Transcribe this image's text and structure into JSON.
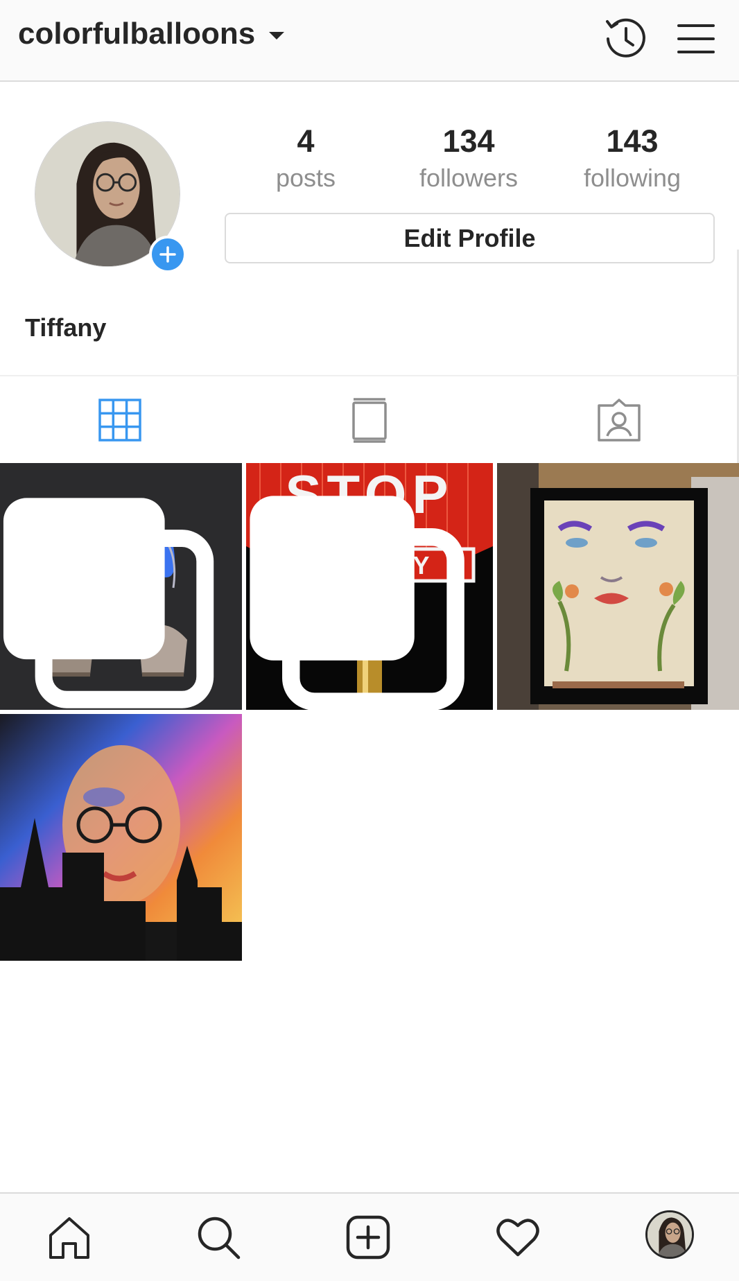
{
  "header": {
    "username": "colorfulballoons",
    "icons": [
      "chevron-down-icon",
      "archive-history-icon",
      "hamburger-menu-icon"
    ]
  },
  "profile": {
    "full_name": "Tiffany",
    "stats": {
      "posts": {
        "count": "4",
        "label": "posts"
      },
      "followers": {
        "count": "134",
        "label": "followers"
      },
      "following": {
        "count": "143",
        "label": "following"
      }
    },
    "edit_button_label": "Edit Profile"
  },
  "tabs": [
    "grid-icon",
    "igtv-icon",
    "tagged-icon"
  ],
  "active_tab": "grid-icon",
  "posts": [
    {
      "subject": "blue light sculptures",
      "multiple": true
    },
    {
      "subject": "stop sign at night",
      "multiple": true
    },
    {
      "subject": "painted face with plants",
      "multiple": false
    },
    {
      "subject": "colorful portrait with skyline",
      "multiple": false
    }
  ],
  "bottom_nav": [
    "home-icon",
    "search-icon",
    "new-post-icon",
    "activity-heart-icon",
    "profile-avatar"
  ],
  "colors": {
    "accent": "#3897f0",
    "text": "#262626",
    "secondary_text": "#8e8e8e",
    "border": "#dbdbdb",
    "bar_bg": "#fafafa"
  }
}
